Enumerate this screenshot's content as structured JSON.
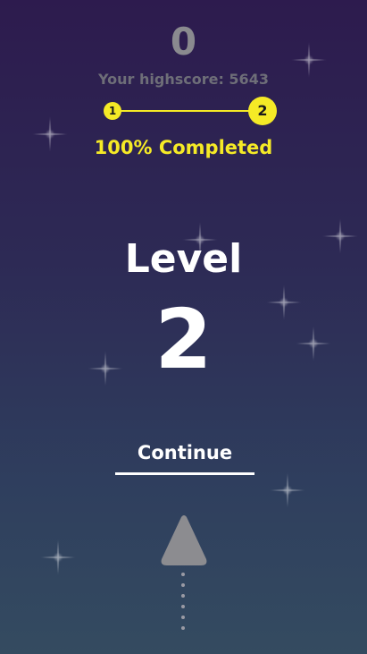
{
  "hud": {
    "score": "0",
    "highscore_text": "Your highscore: 5643"
  },
  "progress": {
    "from_level": "1",
    "to_level": "2",
    "completed_text": "100% Completed",
    "fraction": 1.0,
    "accent_color": "#f5ea26"
  },
  "level": {
    "label": "Level",
    "number": "2"
  },
  "actions": {
    "continue_label": "Continue"
  },
  "player": {
    "icon": "triangle-ship-icon",
    "trail_icon": "dotted-trail-icon"
  },
  "background": {
    "decoration": "sparkle-star-icon"
  }
}
